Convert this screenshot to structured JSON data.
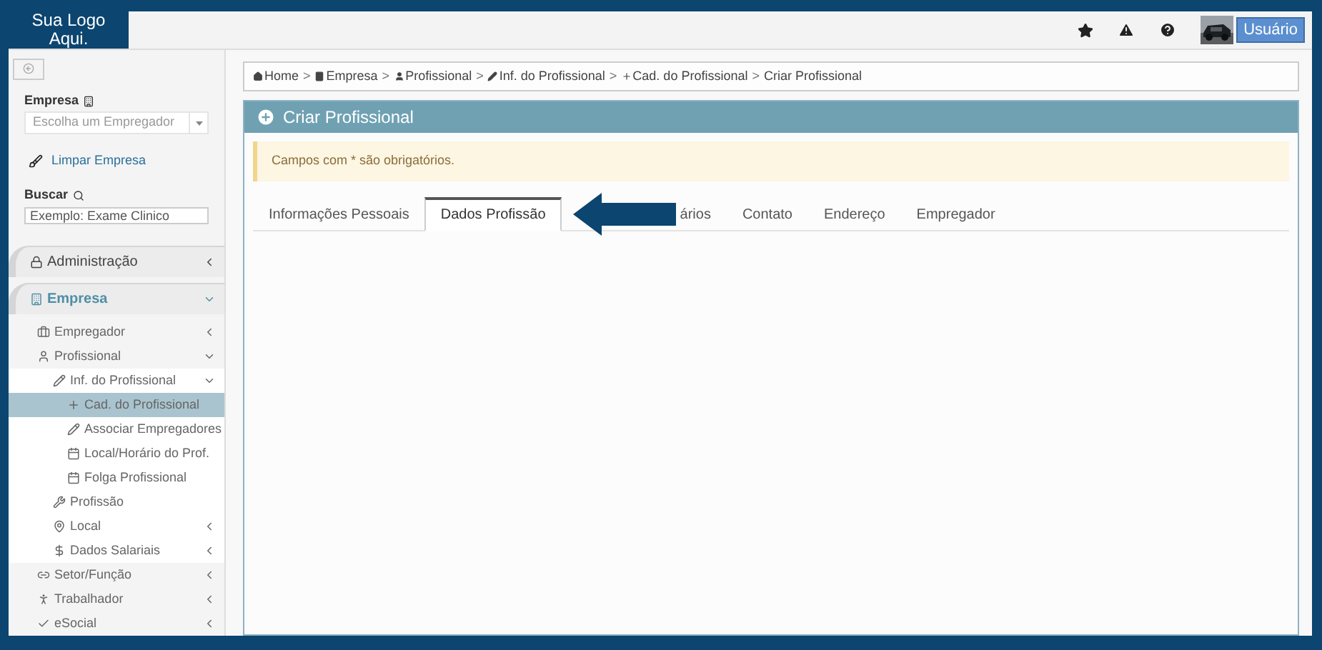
{
  "logo": {
    "text": "Sua Logo Aqui."
  },
  "topbar": {
    "user_button": "Usuário"
  },
  "sidebar": {
    "company_label": "Empresa",
    "company_select": {
      "placeholder": "Escolha um Empregador"
    },
    "clear_link": "Limpar Empresa",
    "search_label": "Buscar",
    "search_field": {
      "placeholder": "Exemplo: Exame Clinico"
    },
    "items": [
      {
        "label": "Administração",
        "expanded": false
      },
      {
        "label": "Empresa",
        "expanded": true,
        "children": [
          {
            "label": "Empregador",
            "expanded": false
          },
          {
            "label": "Profissional",
            "expanded": true,
            "children": [
              {
                "label": "Inf. do Profissional",
                "expanded": true,
                "children": [
                  {
                    "label": "Cad. do Profissional",
                    "selected": true
                  },
                  {
                    "label": "Associar Empregadores",
                    "selected": false
                  },
                  {
                    "label": "Local/Horário do Prof.",
                    "selected": false
                  },
                  {
                    "label": "Folga Profissional",
                    "selected": false
                  }
                ]
              },
              {
                "label": "Profissão"
              },
              {
                "label": "Local",
                "expanded": false
              },
              {
                "label": "Dados Salariais",
                "expanded": false
              }
            ]
          },
          {
            "label": "Setor/Função",
            "expanded": false
          },
          {
            "label": "Trabalhador",
            "expanded": false
          },
          {
            "label": "eSocial",
            "expanded": false
          }
        ]
      }
    ]
  },
  "breadcrumb": [
    {
      "kind": "link",
      "label": "Home"
    },
    {
      "kind": "separator",
      "label": ">"
    },
    {
      "kind": "link",
      "label": "Empresa"
    },
    {
      "kind": "separator",
      "label": ">"
    },
    {
      "kind": "link",
      "label": "Profissional"
    },
    {
      "kind": "separator",
      "label": ">"
    },
    {
      "kind": "link",
      "label": "Inf. do Profissional"
    },
    {
      "kind": "separator",
      "label": ">"
    },
    {
      "kind": "link",
      "label": "Cad. do Profissional"
    },
    {
      "kind": "separator",
      "label": ">"
    },
    {
      "kind": "current",
      "label": "Criar Profissional"
    }
  ],
  "panel": {
    "title": "Criar Profissional",
    "alert": "Campos com * são obrigatórios.",
    "tabs": [
      {
        "label": "Informações Pessoais",
        "selected": false
      },
      {
        "label": "Dados Profissão",
        "selected": true
      },
      {
        "label": "ários",
        "selected": false
      },
      {
        "label": "Contato",
        "selected": false
      },
      {
        "label": "Endereço",
        "selected": false
      },
      {
        "label": "Empregador",
        "selected": false
      }
    ]
  }
}
